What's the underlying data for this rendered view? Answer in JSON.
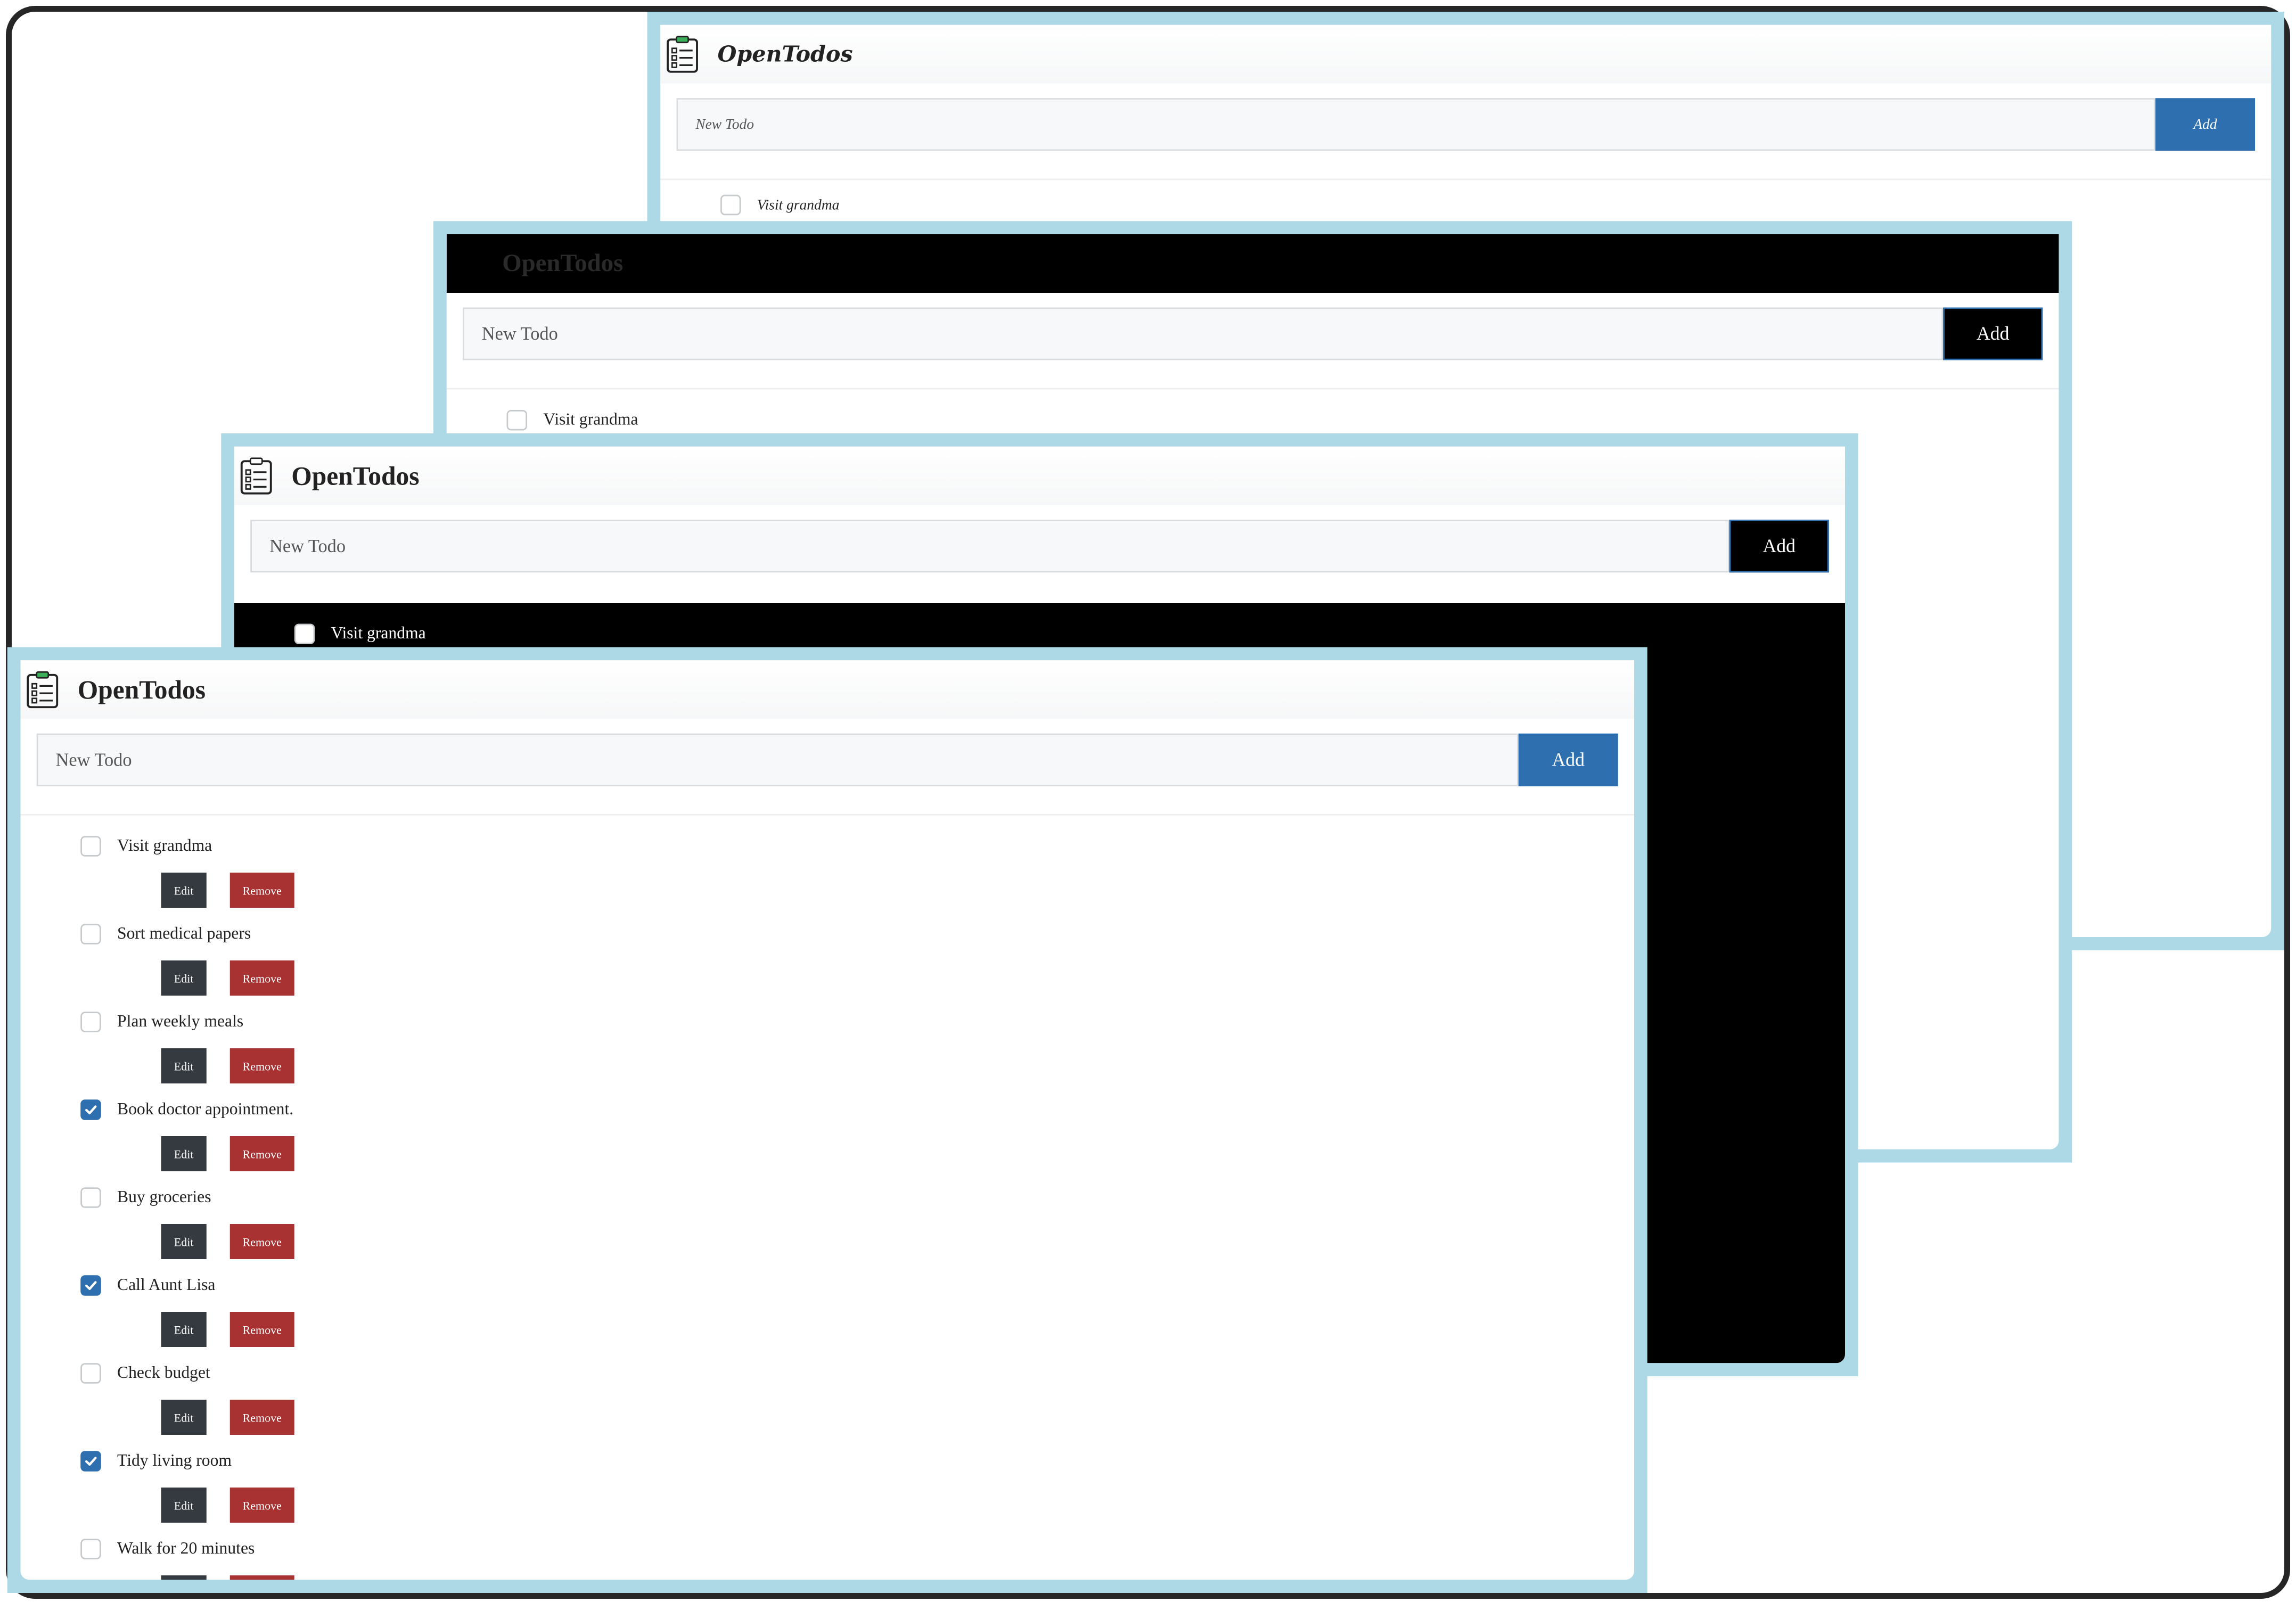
{
  "app": {
    "title": "OpenTodos",
    "input_placeholder": "New Todo",
    "add_label": "Add",
    "edit_label": "Edit",
    "remove_label": "Remove"
  },
  "colors": {
    "panel_border": "#add8e6",
    "add_primary": "#2e6faf",
    "add_dark": "#000000",
    "edit": "#343a40",
    "remove": "#a83232",
    "checked": "#2e6faf"
  },
  "background_panels": [
    {
      "variant": "italic-font",
      "visible_todo": "Visit grandma"
    },
    {
      "variant": "dark-header",
      "visible_todo": "Visit grandma"
    },
    {
      "variant": "dark-list",
      "visible_todo": "Visit grandma"
    }
  ],
  "todos": [
    {
      "text": "Visit grandma",
      "done": false
    },
    {
      "text": "Sort medical papers",
      "done": false
    },
    {
      "text": "Plan weekly meals",
      "done": false
    },
    {
      "text": "Book doctor appointment.",
      "done": true
    },
    {
      "text": "Buy groceries",
      "done": false
    },
    {
      "text": "Call Aunt Lisa",
      "done": true
    },
    {
      "text": "Check budget",
      "done": false
    },
    {
      "text": "Tidy living room",
      "done": true
    },
    {
      "text": "Walk for 20 minutes",
      "done": false
    }
  ]
}
